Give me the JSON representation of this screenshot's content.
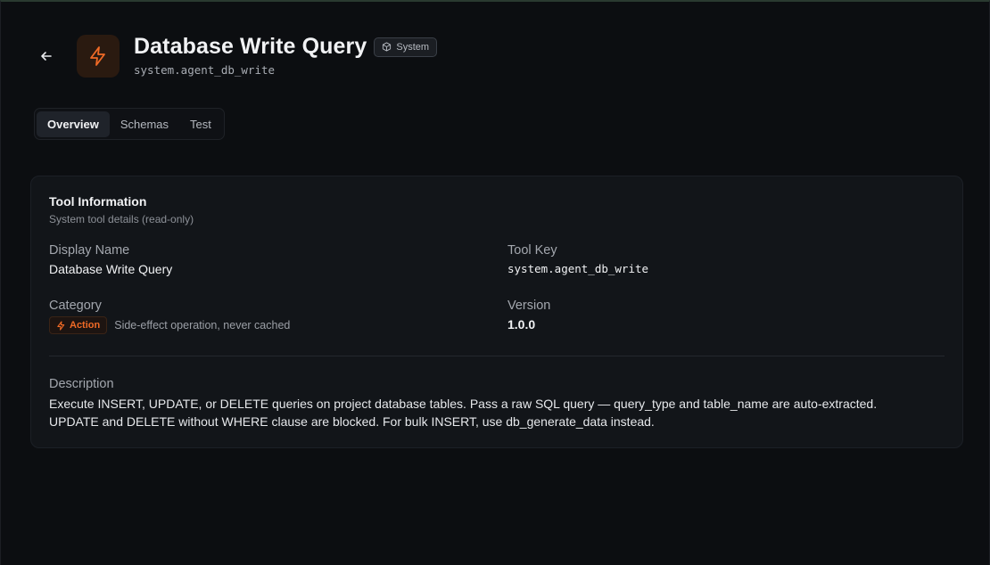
{
  "header": {
    "title": "Database Write Query",
    "badge": "System",
    "tool_key": "system.agent_db_write",
    "accent_color": "#f06a26"
  },
  "tabs": [
    {
      "label": "Overview",
      "active": true
    },
    {
      "label": "Schemas",
      "active": false
    },
    {
      "label": "Test",
      "active": false
    }
  ],
  "card": {
    "title": "Tool Information",
    "subtitle": "System tool details (read-only)",
    "display_name_label": "Display Name",
    "display_name_value": "Database Write Query",
    "tool_key_label": "Tool Key",
    "tool_key_value": "system.agent_db_write",
    "category_label": "Category",
    "category_badge": "Action",
    "category_desc": "Side-effect operation, never cached",
    "version_label": "Version",
    "version_value": "1.0.0",
    "description_label": "Description",
    "description_value": "Execute INSERT, UPDATE, or DELETE queries on project database tables. Pass a raw SQL query — query_type and table_name are auto-extracted. UPDATE and DELETE without WHERE clause are blocked. For bulk INSERT, use db_generate_data instead."
  }
}
